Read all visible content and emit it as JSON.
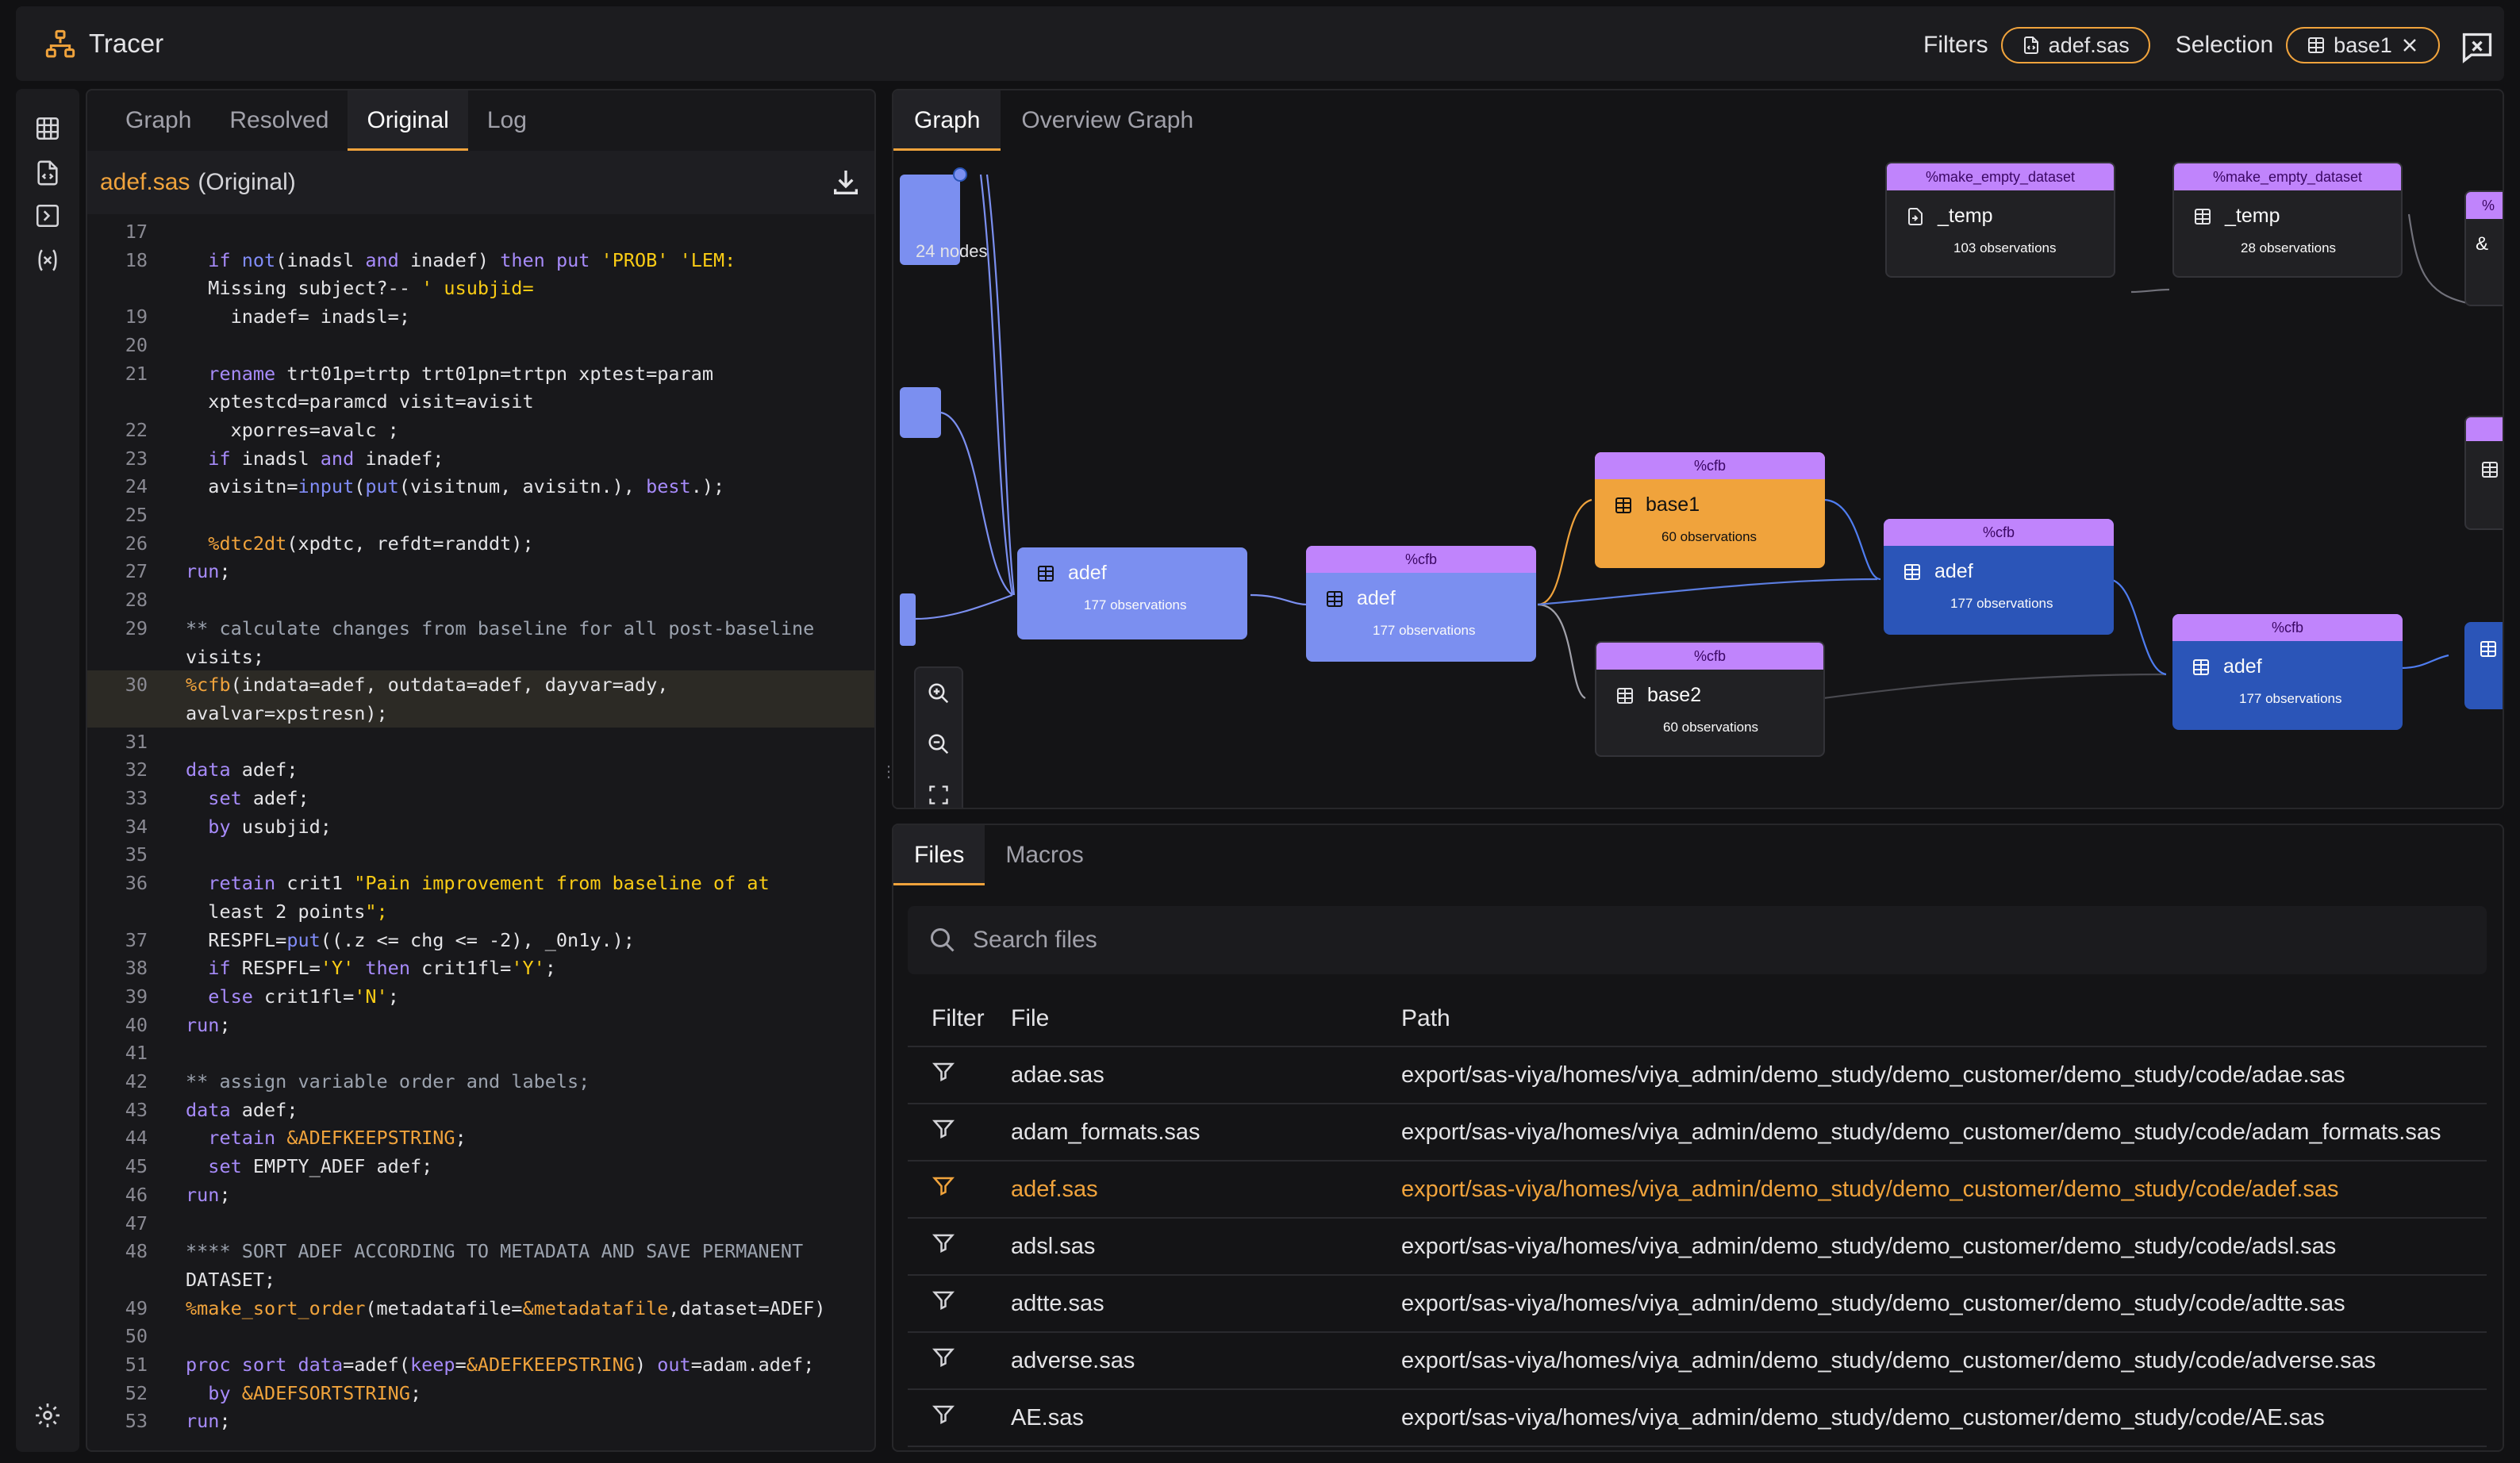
{
  "app": {
    "title": "Tracer"
  },
  "header": {
    "filters_label": "Filters",
    "filter_chip": "adef.sas",
    "selection_label": "Selection",
    "selection_chip": "base1"
  },
  "left_panel": {
    "tabs": [
      "Graph",
      "Resolved",
      "Original",
      "Log"
    ],
    "active_tab": "Original",
    "file_name": "adef.sas",
    "file_mode": "(Original)"
  },
  "code": [
    {
      "n": "17",
      "t": ""
    },
    {
      "n": "18",
      "t": "  if not(inadsl and inadef) then put 'PROB' 'LEM:"
    },
    {
      "n": "",
      "t": "  Missing subject?-- ' usubjid="
    },
    {
      "n": "19",
      "t": "    inadef= inadsl=;"
    },
    {
      "n": "20",
      "t": ""
    },
    {
      "n": "21",
      "t": "  rename trt01p=trtp trt01pn=trtpn xptest=param"
    },
    {
      "n": "",
      "t": "  xptestcd=paramcd visit=avisit"
    },
    {
      "n": "22",
      "t": "    xporres=avalc ;"
    },
    {
      "n": "23",
      "t": "  if inadsl and inadef;"
    },
    {
      "n": "24",
      "t": "  avisitn=input(put(visitnum, avisitn.), best.);"
    },
    {
      "n": "25",
      "t": ""
    },
    {
      "n": "26",
      "t": "  %dtc2dt(xpdtc, refdt=randdt);"
    },
    {
      "n": "27",
      "t": "run;"
    },
    {
      "n": "28",
      "t": ""
    },
    {
      "n": "29",
      "t": "** calculate changes from baseline for all post-baseline"
    },
    {
      "n": "",
      "t": "visits;"
    },
    {
      "n": "30",
      "t": "%cfb(indata=adef, outdata=adef, dayvar=ady,"
    },
    {
      "n": "",
      "t": "avalvar=xpstresn);"
    },
    {
      "n": "31",
      "t": ""
    },
    {
      "n": "32",
      "t": "data adef;"
    },
    {
      "n": "33",
      "t": "  set adef;"
    },
    {
      "n": "34",
      "t": "  by usubjid;"
    },
    {
      "n": "35",
      "t": ""
    },
    {
      "n": "36",
      "t": "  retain crit1 \"Pain improvement from baseline of at"
    },
    {
      "n": "",
      "t": "  least 2 points\";"
    },
    {
      "n": "37",
      "t": "  RESPFL=put((.z <= chg <= -2), _0n1y.);"
    },
    {
      "n": "38",
      "t": "  if RESPFL='Y' then crit1fl='Y';"
    },
    {
      "n": "39",
      "t": "  else crit1fl='N';"
    },
    {
      "n": "40",
      "t": "run;"
    },
    {
      "n": "41",
      "t": ""
    },
    {
      "n": "42",
      "t": "** assign variable order and labels;"
    },
    {
      "n": "43",
      "t": "data adef;"
    },
    {
      "n": "44",
      "t": "  retain &ADEFKEEPSTRING;"
    },
    {
      "n": "45",
      "t": "  set EMPTY_ADEF adef;"
    },
    {
      "n": "46",
      "t": "run;"
    },
    {
      "n": "47",
      "t": ""
    },
    {
      "n": "48",
      "t": "**** SORT ADEF ACCORDING TO METADATA AND SAVE PERMANENT"
    },
    {
      "n": "",
      "t": "DATASET;"
    },
    {
      "n": "49",
      "t": "%make_sort_order(metadatafile=&metadatafile,dataset=ADEF)"
    },
    {
      "n": "50",
      "t": ""
    },
    {
      "n": "51",
      "t": "proc sort data=adef(keep=&ADEFKEEPSTRING) out=adam.adef;"
    },
    {
      "n": "52",
      "t": "  by &ADEFSORTSTRING;"
    },
    {
      "n": "53",
      "t": "run;"
    }
  ],
  "graph_panel": {
    "tabs": [
      "Graph",
      "Overview Graph"
    ],
    "active_tab": "Graph",
    "node_count": "24 nodes",
    "nodes": [
      {
        "macro": "",
        "name": "adef",
        "obs": "177 observations",
        "style": "light"
      },
      {
        "macro": "%cfb",
        "name": "adef",
        "obs": "177 observations",
        "style": "light"
      },
      {
        "macro": "%cfb",
        "name": "base1",
        "obs": "60 observations",
        "style": "orange"
      },
      {
        "macro": "%cfb",
        "name": "base2",
        "obs": "60 observations",
        "style": "dark"
      },
      {
        "macro": "%cfb",
        "name": "adef",
        "obs": "177 observations",
        "style": "blue"
      },
      {
        "macro": "%cfb",
        "name": "adef",
        "obs": "177 observations",
        "style": "blue"
      },
      {
        "macro": "%make_empty_dataset",
        "name": "_temp",
        "obs": "103 observations",
        "style": "dark"
      },
      {
        "macro": "%make_empty_dataset",
        "name": "_temp",
        "obs": "28 observations",
        "style": "dark"
      }
    ],
    "partial_labels": {
      "amp": "&",
      "pct": "%"
    }
  },
  "files_panel": {
    "tabs": [
      "Files",
      "Macros"
    ],
    "active_tab": "Files",
    "search_placeholder": "Search files",
    "columns": [
      "Filter",
      "File",
      "Path"
    ],
    "rows": [
      {
        "file": "adae.sas",
        "path": "export/sas-viya/homes/viya_admin/demo_study/demo_customer/demo_study/code/adae.sas",
        "active": false
      },
      {
        "file": "adam_formats.sas",
        "path": "export/sas-viya/homes/viya_admin/demo_study/demo_customer/demo_study/code/adam_formats.sas",
        "active": false
      },
      {
        "file": "adef.sas",
        "path": "export/sas-viya/homes/viya_admin/demo_study/demo_customer/demo_study/code/adef.sas",
        "active": true
      },
      {
        "file": "adsl.sas",
        "path": "export/sas-viya/homes/viya_admin/demo_study/demo_customer/demo_study/code/adsl.sas",
        "active": false
      },
      {
        "file": "adtte.sas",
        "path": "export/sas-viya/homes/viya_admin/demo_study/demo_customer/demo_study/code/adtte.sas",
        "active": false
      },
      {
        "file": "adverse.sas",
        "path": "export/sas-viya/homes/viya_admin/demo_study/demo_customer/demo_study/code/adverse.sas",
        "active": false
      },
      {
        "file": "AE.sas",
        "path": "export/sas-viya/homes/viya_admin/demo_study/demo_customer/demo_study/code/AE.sas",
        "active": false
      }
    ]
  },
  "colors": {
    "accent": "#f0a33c",
    "node_light": "#7b8ff0",
    "node_blue": "#2b55b8",
    "macro_header": "#c084fc",
    "node_dark": "#212124"
  }
}
